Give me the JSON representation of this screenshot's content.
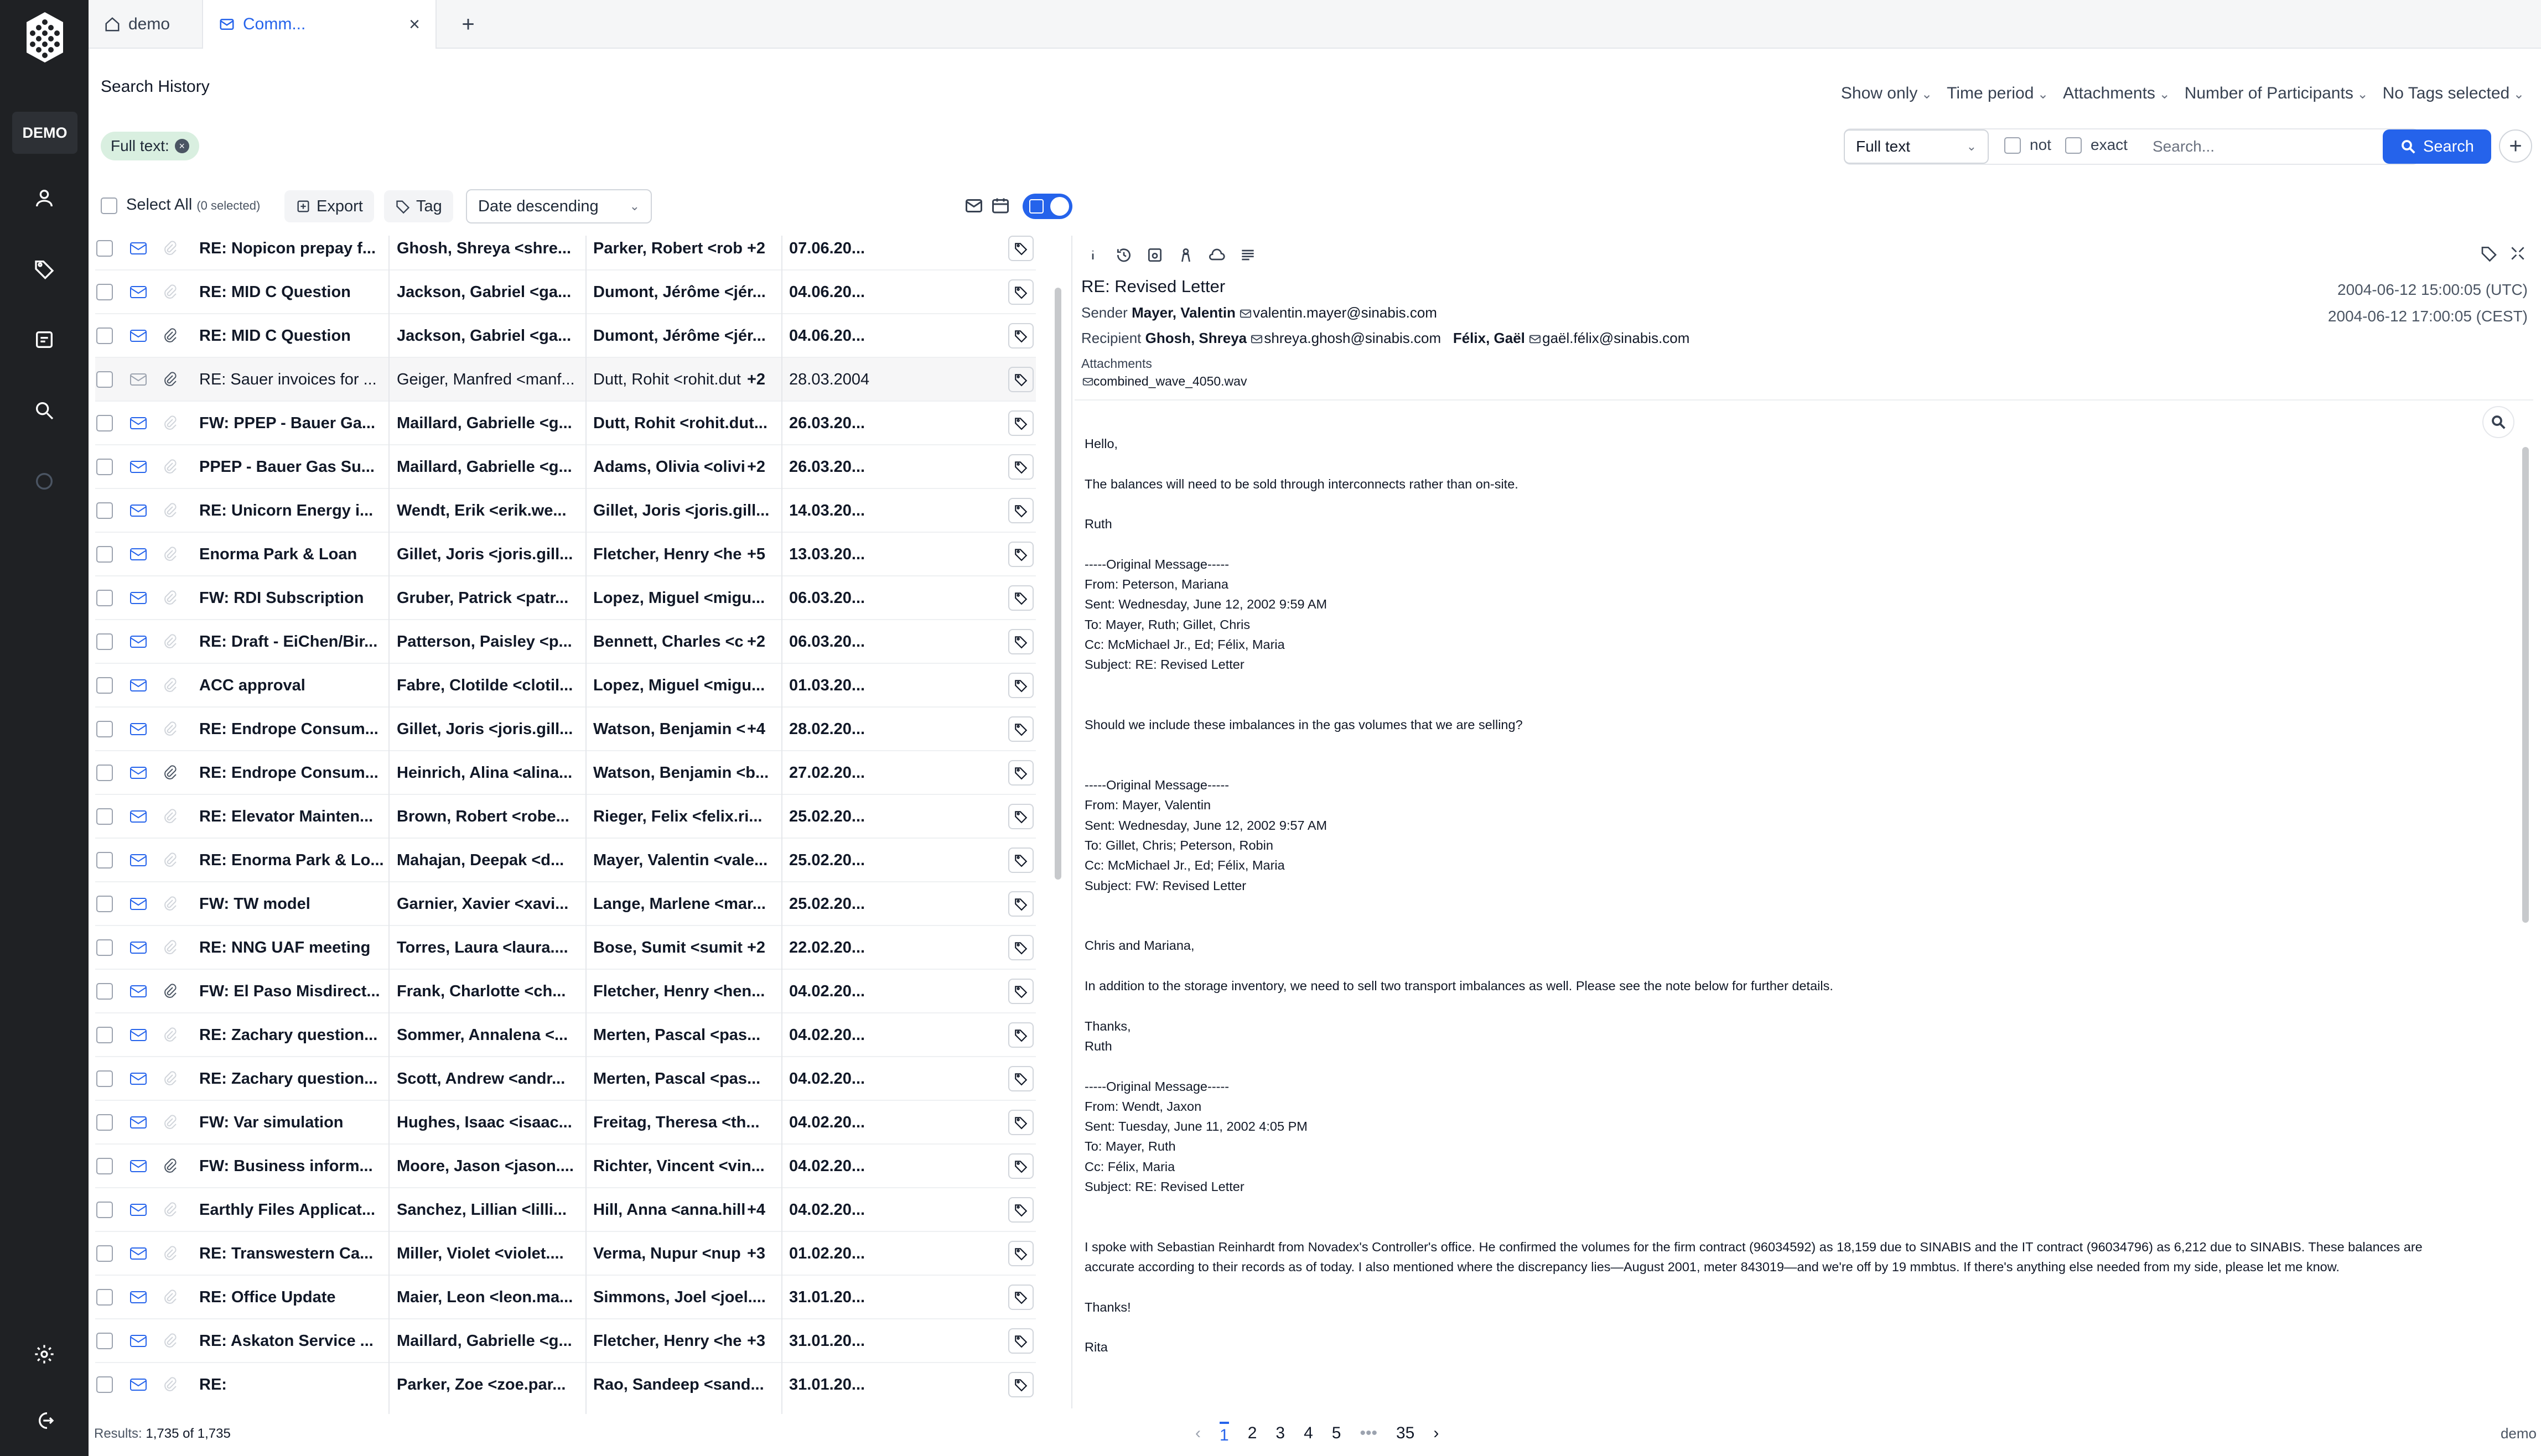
{
  "tabs": [
    {
      "label": "demo",
      "icon": "home-icon"
    },
    {
      "label": "Comm...",
      "icon": "mail-icon"
    }
  ],
  "sidebar": {
    "badge": "DEMO"
  },
  "header": {
    "title": "Search History"
  },
  "filters": [
    "Show only",
    "Time period",
    "Attachments",
    "Number of Participants",
    "No Tags selected"
  ],
  "chip": {
    "label": "Full text:"
  },
  "query": {
    "mode": "Full text",
    "not_label": "not",
    "exact_label": "exact",
    "placeholder": "Search...",
    "button": "Search"
  },
  "toolbar": {
    "select_all": "Select All",
    "selected": "(0 selected)",
    "export": "Export",
    "tag": "Tag",
    "sort": "Date descending"
  },
  "rows": [
    {
      "subject": "RE: Nopicon prepay f...",
      "from": "Ghosh, Shreya <shre...",
      "to": "Parker, Robert <rob",
      "more": "+2",
      "date": "07.06.20...",
      "read": false,
      "attach": false
    },
    {
      "subject": "RE: MID C Question",
      "from": "Jackson, Gabriel <ga...",
      "to": "Dumont, Jérôme <jér...",
      "more": "",
      "date": "04.06.20...",
      "read": false,
      "attach": false
    },
    {
      "subject": "RE: MID C Question",
      "from": "Jackson, Gabriel <ga...",
      "to": "Dumont, Jérôme <jér...",
      "more": "",
      "date": "04.06.20...",
      "read": false,
      "attach": true
    },
    {
      "subject": "RE: Sauer invoices for ...",
      "from": "Geiger, Manfred <manf...",
      "to": "Dutt, Rohit <rohit.dut",
      "more": "+2",
      "date": "28.03.2004",
      "read": true,
      "attach": true
    },
    {
      "subject": "FW: PPEP - Bauer Ga...",
      "from": "Maillard, Gabrielle <g...",
      "to": "Dutt, Rohit <rohit.dut...",
      "more": "",
      "date": "26.03.20...",
      "read": false,
      "attach": false
    },
    {
      "subject": "PPEP - Bauer Gas Su...",
      "from": "Maillard, Gabrielle <g...",
      "to": "Adams, Olivia <olivi",
      "more": "+2",
      "date": "26.03.20...",
      "read": false,
      "attach": false
    },
    {
      "subject": "RE: Unicorn Energy i...",
      "from": "Wendt, Erik <erik.we...",
      "to": "Gillet, Joris <joris.gill...",
      "more": "",
      "date": "14.03.20...",
      "read": false,
      "attach": false
    },
    {
      "subject": "Enorma Park & Loan",
      "from": "Gillet, Joris <joris.gill...",
      "to": "Fletcher, Henry <he",
      "more": "+5",
      "date": "13.03.20...",
      "read": false,
      "attach": false
    },
    {
      "subject": "FW: RDI Subscription",
      "from": "Gruber, Patrick <patr...",
      "to": "Lopez, Miguel <migu...",
      "more": "",
      "date": "06.03.20...",
      "read": false,
      "attach": false
    },
    {
      "subject": "RE: Draft - EiChen/Bir...",
      "from": "Patterson, Paisley <p...",
      "to": "Bennett, Charles <c",
      "more": "+2",
      "date": "06.03.20...",
      "read": false,
      "attach": false
    },
    {
      "subject": "ACC approval",
      "from": "Fabre, Clotilde <clotil...",
      "to": "Lopez, Miguel <migu...",
      "more": "",
      "date": "01.03.20...",
      "read": false,
      "attach": false
    },
    {
      "subject": "RE: Endrope Consum...",
      "from": "Gillet, Joris <joris.gill...",
      "to": "Watson, Benjamin <",
      "more": "+4",
      "date": "28.02.20...",
      "read": false,
      "attach": false
    },
    {
      "subject": "RE: Endrope Consum...",
      "from": "Heinrich, Alina <alina...",
      "to": "Watson, Benjamin <b...",
      "more": "",
      "date": "27.02.20...",
      "read": false,
      "attach": true
    },
    {
      "subject": "RE: Elevator Mainten...",
      "from": "Brown, Robert <robe...",
      "to": "Rieger, Felix <felix.ri...",
      "more": "",
      "date": "25.02.20...",
      "read": false,
      "attach": false
    },
    {
      "subject": "RE: Enorma Park & Lo...",
      "from": "Mahajan, Deepak <d...",
      "to": "Mayer, Valentin <vale...",
      "more": "",
      "date": "25.02.20...",
      "read": false,
      "attach": false
    },
    {
      "subject": "FW: TW model",
      "from": "Garnier, Xavier <xavi...",
      "to": "Lange, Marlene <mar...",
      "more": "",
      "date": "25.02.20...",
      "read": false,
      "attach": false
    },
    {
      "subject": "RE: NNG UAF meeting",
      "from": "Torres, Laura <laura....",
      "to": "Bose, Sumit <sumit",
      "more": "+2",
      "date": "22.02.20...",
      "read": false,
      "attach": false
    },
    {
      "subject": "FW: El Paso Misdirect...",
      "from": "Frank, Charlotte <ch...",
      "to": "Fletcher, Henry <hen...",
      "more": "",
      "date": "04.02.20...",
      "read": false,
      "attach": true
    },
    {
      "subject": "RE: Zachary question...",
      "from": "Sommer, Annalena <...",
      "to": "Merten, Pascal <pas...",
      "more": "",
      "date": "04.02.20...",
      "read": false,
      "attach": false
    },
    {
      "subject": "RE: Zachary question...",
      "from": "Scott, Andrew <andr...",
      "to": "Merten, Pascal <pas...",
      "more": "",
      "date": "04.02.20...",
      "read": false,
      "attach": false
    },
    {
      "subject": "FW: Var simulation",
      "from": "Hughes, Isaac <isaac...",
      "to": "Freitag, Theresa <th...",
      "more": "",
      "date": "04.02.20...",
      "read": false,
      "attach": false
    },
    {
      "subject": "FW: Business inform...",
      "from": "Moore, Jason <jason....",
      "to": "Richter, Vincent <vin...",
      "more": "",
      "date": "04.02.20...",
      "read": false,
      "attach": true
    },
    {
      "subject": "Earthly Files Applicat...",
      "from": "Sanchez, Lillian <lilli...",
      "to": "Hill, Anna <anna.hill",
      "more": "+4",
      "date": "04.02.20...",
      "read": false,
      "attach": false
    },
    {
      "subject": "RE: Transwestern Ca...",
      "from": "Miller, Violet <violet....",
      "to": "Verma, Nupur <nup",
      "more": "+3",
      "date": "01.02.20...",
      "read": false,
      "attach": false
    },
    {
      "subject": "RE: Office Update",
      "from": "Maier, Leon <leon.ma...",
      "to": "Simmons, Joel <joel....",
      "more": "",
      "date": "31.01.20...",
      "read": false,
      "attach": false
    },
    {
      "subject": "RE: Askaton Service ...",
      "from": "Maillard, Gabrielle <g...",
      "to": "Fletcher, Henry <he",
      "more": "+3",
      "date": "31.01.20...",
      "read": false,
      "attach": false
    },
    {
      "subject": "RE:",
      "from": "Parker, Zoe <zoe.par...",
      "to": "Rao, Sandeep <sand...",
      "more": "",
      "date": "31.01.20...",
      "read": false,
      "attach": false
    }
  ],
  "results": {
    "label": "Results:",
    "value": "1,735 of 1,735"
  },
  "pager": {
    "pages": [
      "1",
      "2",
      "3",
      "4",
      "5",
      "•••",
      "35"
    ],
    "current": "1"
  },
  "footer_user": "demo",
  "detail": {
    "subject": "RE: Revised Letter",
    "date_utc": "2004-06-12 15:00:05 (UTC)",
    "date_local": "2004-06-12 17:00:05 (CEST)",
    "sender_label": "Sender",
    "sender_name": "Mayer, Valentin",
    "sender_email": "valentin.mayer@sinabis.com",
    "recipient_label": "Recipient",
    "recipient1_name": "Ghosh, Shreya",
    "recipient1_email": "shreya.ghosh@sinabis.com",
    "recipient2_name": "Félix, Gaël",
    "recipient2_email": "gaël.félix@sinabis.com",
    "attachments_label": "Attachments",
    "attachment_file": "combined_wave_4050.wav",
    "body": "Hello,\n\nThe balances will need to be sold through interconnects rather than on-site.\n\nRuth\n\n-----Original Message-----\nFrom: Peterson, Mariana\nSent: Wednesday, June 12, 2002 9:59 AM\nTo: Mayer, Ruth; Gillet, Chris\nCc: McMichael Jr., Ed; Félix, Maria\nSubject: RE: Revised Letter\n\n\nShould we include these imbalances in the gas volumes that we are selling?\n\n\n-----Original Message-----\nFrom: Mayer, Valentin\nSent: Wednesday, June 12, 2002 9:57 AM\nTo: Gillet, Chris; Peterson, Robin\nCc: McMichael Jr., Ed; Félix, Maria\nSubject: FW: Revised Letter\n\n\nChris and Mariana,\n\nIn addition to the storage inventory, we need to sell two transport imbalances as well. Please see the note below for further details.\n\nThanks,\nRuth\n\n-----Original Message-----\nFrom: Wendt, Jaxon\nSent: Tuesday, June 11, 2002 4:05 PM\nTo: Mayer, Ruth\nCc: Félix, Maria\nSubject: RE: Revised Letter\n\n\nI spoke with Sebastian Reinhardt from Novadex's Controller's office. He confirmed the volumes for the firm contract (96034592) as 18,159 due to SINABIS and the IT contract (96034796) as 6,212 due to SINABIS. These balances are\naccurate according to their records as of today. I also mentioned where the discrepancy lies—August 2001, meter 843019—and we're off by 19 mmbtus. If there's anything else needed from my side, please let me know.\n\nThanks!\n\nRita"
  },
  "colors": {
    "accent": "#2563eb",
    "sidebar": "#1f2124",
    "chip": "#d9efe0"
  }
}
